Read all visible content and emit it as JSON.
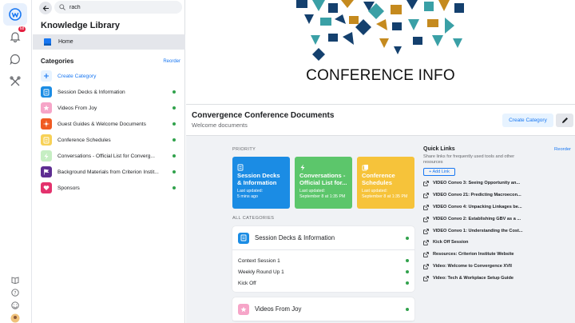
{
  "rail": {
    "notification_count": "68"
  },
  "search": {
    "value": "rach"
  },
  "sidebar": {
    "title": "Knowledge Library",
    "home_label": "Home",
    "categories_label": "Categories",
    "reorder_label": "Reorder",
    "create_category_label": "Create Category",
    "categories": [
      {
        "label": "Session Decks & Information",
        "color": "#1b8ce4"
      },
      {
        "label": "Videos From Joy",
        "color": "#f6a5c8"
      },
      {
        "label": "Guest Guides & Welcome Documents",
        "color": "#f05a22"
      },
      {
        "label": "Conference Schedules",
        "color": "#f7d157"
      },
      {
        "label": "Conversations - Official List for Converg...",
        "color": "#c6eec3"
      },
      {
        "label": "Background Materials from Criterion Instit...",
        "color": "#5d2d91"
      },
      {
        "label": "Sponsors",
        "color": "#e3326d"
      }
    ]
  },
  "banner": {
    "title": "CONFERENCE INFO"
  },
  "header": {
    "title": "Convergence Conference Documents",
    "subtitle": "Welcome documents",
    "create_category_label": "Create Category"
  },
  "priority": {
    "label": "PRIORITY",
    "cards": [
      {
        "title": "Session Decks & Information",
        "updated_label": "Last updated:",
        "updated": "5 mins ago",
        "color": "#1b8ce4"
      },
      {
        "title": "Conversations - Official List for...",
        "updated_label": "Last updated:",
        "updated": "September 8 at 1:35 PM",
        "color": "#5cc66b"
      },
      {
        "title": "Conference Schedules",
        "updated_label": "Last updated:",
        "updated": "September 8 at 1:35 PM",
        "color": "#f6c33a"
      }
    ]
  },
  "all_categories": {
    "label": "ALL CATEGORIES",
    "cards": [
      {
        "title": "Session Decks & Information",
        "rows": [
          "Context Session 1",
          "Weekly Round Up 1",
          "Kick Off"
        ]
      },
      {
        "title": "Videos From Joy",
        "rows": []
      }
    ]
  },
  "quick_links": {
    "title": "Quick Links",
    "reorder_label": "Reorder",
    "description": "Share links for frequently used tools and other resources",
    "add_link_label": "+ Add Link",
    "items": [
      "VIDEO Convo 3: Seeing Opportunity an...",
      "VIDEO Convo 21: Predicting Macroecon...",
      "VIDEO Convo 4: Unpacking Linkages be...",
      "VIDEO Convo 2: Establishing GBV as a ...",
      "VIDEO Convo 1: Understanding the Cost...",
      "Kick Off Session",
      "Resources: Criterion Institute Website",
      "Video: Welcome to Convergence XVII",
      "Video: Tech & Workplace Setup Guide"
    ]
  }
}
